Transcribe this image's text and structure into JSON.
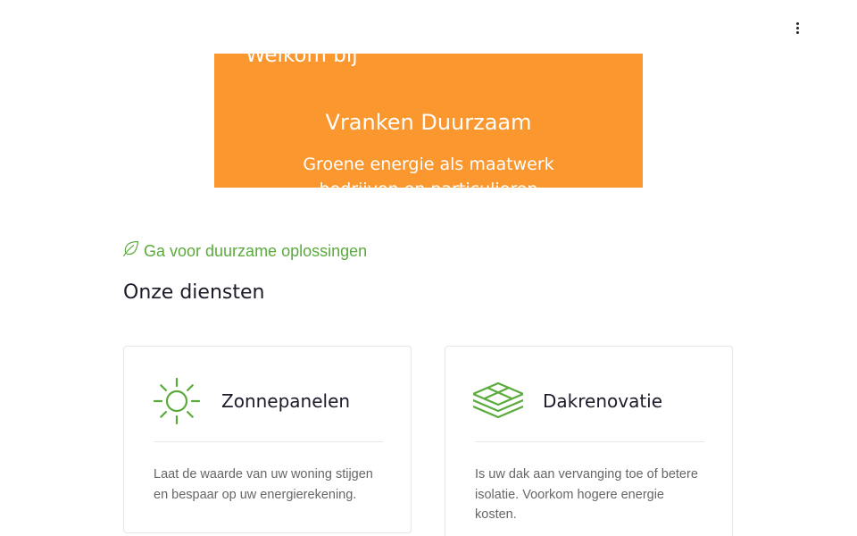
{
  "header": {
    "menu_icon": "kebab-menu-icon"
  },
  "hero": {
    "welcome": "Welkom bij",
    "title": "Vranken Duurzaam",
    "subtitle": "Groene energie als maatwerk",
    "subtitle_line2": "bedrijven en particulieren",
    "background_color": "#fa972f"
  },
  "section": {
    "tagline": "Ga voor duurzame oplossingen",
    "tagline_icon": "leaf-icon",
    "title": "Onze diensten",
    "accent_color": "#5aab3c"
  },
  "services": [
    {
      "icon": "sun-icon",
      "title": "Zonnepanelen",
      "description": "Laat de waarde van uw woning stijgen en bespaar op uw energierekening."
    },
    {
      "icon": "layers-icon",
      "title": "Dakrenovatie",
      "description": "Is uw dak aan vervanging toe of betere isolatie. Voorkom hogere energie kosten."
    }
  ]
}
